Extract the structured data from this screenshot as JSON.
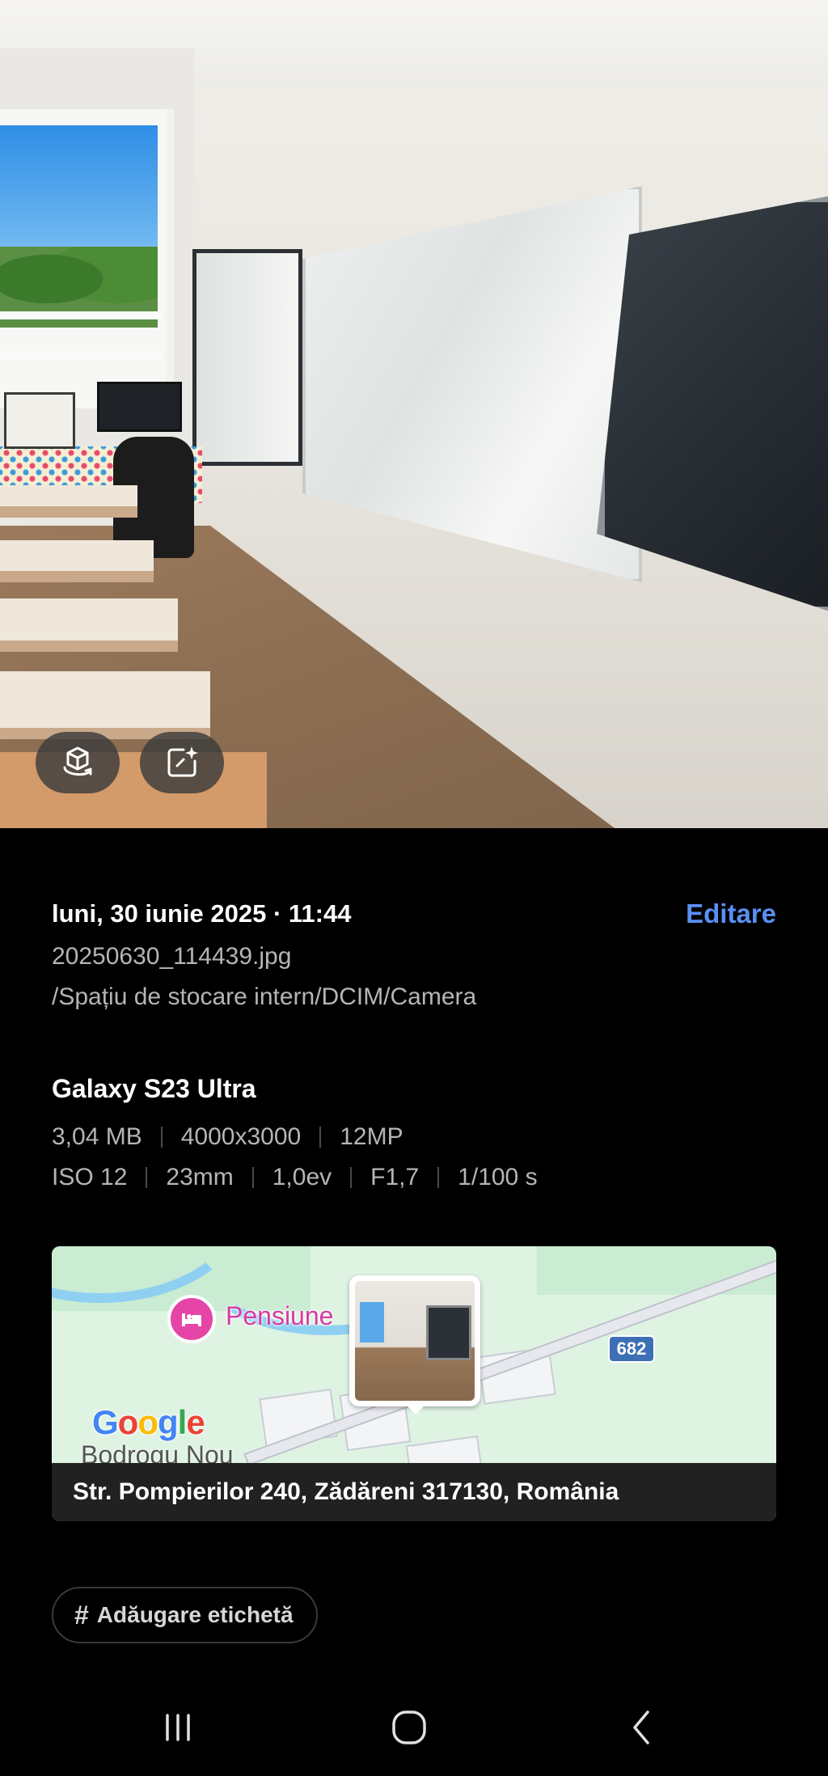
{
  "photo": {
    "buttons": [
      {
        "name": "3d-view",
        "icon": "cube-rotate-icon"
      },
      {
        "name": "ai-edit",
        "icon": "sparkle-edit-icon"
      }
    ]
  },
  "details": {
    "date": "luni, 30 iunie 2025 · 11:44",
    "edit_label": "Editare",
    "filename": "20250630_114439.jpg",
    "path": "/Spațiu de stocare intern/DCIM/Camera",
    "device": "Galaxy S23 Ultra",
    "specs_row1": [
      "3,04 MB",
      "4000x3000",
      "12MP"
    ],
    "specs_row2": [
      "ISO 12",
      "23mm",
      "1,0ev",
      "F1,7",
      "1/100 s"
    ]
  },
  "map": {
    "poi_label": "Pensiune",
    "route_number": "682",
    "logo_letters": [
      "G",
      "o",
      "o",
      "g",
      "l",
      "e"
    ],
    "village": "Bodrogu Nou",
    "address": "Str. Pompierilor 240, Zădăreni 317130, România",
    "poi_color": "#e445a6"
  },
  "tag": {
    "label": "Adăugare etichetă"
  },
  "nav": {
    "recents_icon": "recents-icon",
    "home_icon": "home-icon",
    "back_icon": "back-icon"
  },
  "colors": {
    "accent": "#5b8ff4",
    "background": "#000000",
    "secondary_text": "#b5b5b5"
  }
}
